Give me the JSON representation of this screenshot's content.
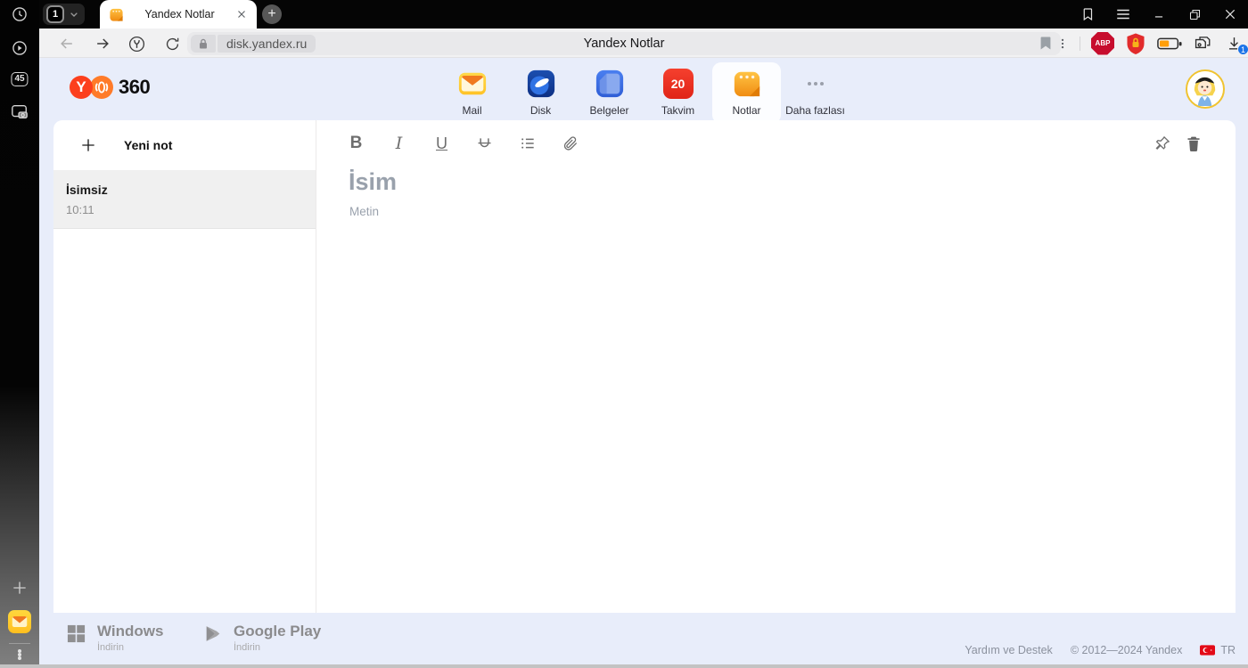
{
  "window": {
    "tab_group_count": "1",
    "tab_title": "Yandex Notlar",
    "new_tab_glyph": "+",
    "sidebar_tab_badge": "45",
    "page_title": "Yandex Notlar",
    "url": "disk.yandex.ru",
    "abp_label": "ABP",
    "download_badge": "1"
  },
  "header": {
    "logo_y": "Y",
    "logo_text": "360",
    "apps": [
      {
        "label": "Mail"
      },
      {
        "label": "Disk"
      },
      {
        "label": "Belgeler"
      },
      {
        "label": "Takvim",
        "badge": "20"
      },
      {
        "label": "Notlar"
      },
      {
        "label": "Daha fazlası"
      }
    ]
  },
  "notes_panel": {
    "new_note_label": "Yeni not",
    "notes": [
      {
        "title": "İsimsiz",
        "time": "10:11"
      }
    ]
  },
  "editor": {
    "bold_label": "B",
    "italic_label": "I",
    "underline_label": "U",
    "title_placeholder": "İsim",
    "body_placeholder": "Metin"
  },
  "footer": {
    "windows_title": "Windows",
    "windows_sub": "İndirin",
    "gplay_title": "Google Play",
    "gplay_sub": "İndirin",
    "help_label": "Yardım ve Destek",
    "copyright": "© 2012—2024 Yandex",
    "lang": "TR"
  },
  "colors": {
    "page_lavender": "#e8edfa",
    "notes_orange": "#f7a223",
    "takvim_red": "#ef3124",
    "brand_red": "#fc3f1d",
    "download_badge_blue": "#1a73e8"
  }
}
